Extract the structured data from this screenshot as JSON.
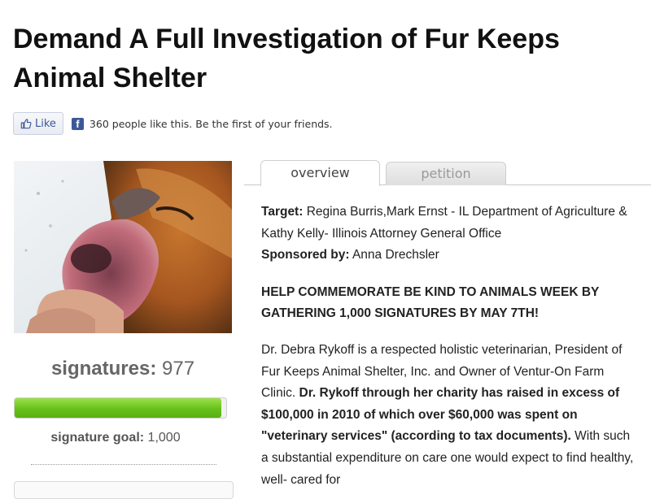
{
  "title": "Demand A Full Investigation of Fur Keeps Animal Shelter",
  "like_bar": {
    "like_label": "Like",
    "fb_icon_letter": "f",
    "text": "360 people like this. Be the first of your friends.",
    "accent_color": "#3b5998"
  },
  "photo": {
    "subject": "injured fox held in a hand against snow"
  },
  "signatures": {
    "label": "signatures:",
    "count": "977",
    "progress_fraction": 0.977,
    "goal_label": "signature goal:",
    "goal_value": "1,000",
    "bar_color": "#66c11a"
  },
  "tabs": [
    {
      "label": "overview",
      "active": true
    },
    {
      "label": "petition",
      "active": false
    }
  ],
  "details": {
    "target_label": "Target:",
    "target_value": "Regina Burris,Mark Ernst - IL Department of Agriculture & Kathy Kelly- Illinois Attorney General Office",
    "sponsor_label": "Sponsored by:",
    "sponsor_value": "Anna Drechsler",
    "headline": "HELP COMMEMORATE BE KIND TO ANIMALS WEEK BY GATHERING 1,000 SIGNATURES BY MAY 7TH!",
    "body_intro": "Dr. Debra Rykoff is a respected holistic veterinarian, President of Fur Keeps Animal Shelter, Inc. and Owner of Ventur-On Farm Clinic.",
    "body_bold": "Dr. Rykoff through her charity has raised in excess of $100,000 in 2010 of which over $60,000 was spent on \"veterinary services\" (according to tax documents).",
    "body_rest": "With such a substantial expenditure on care one would expect to find healthy, well- cared for"
  }
}
